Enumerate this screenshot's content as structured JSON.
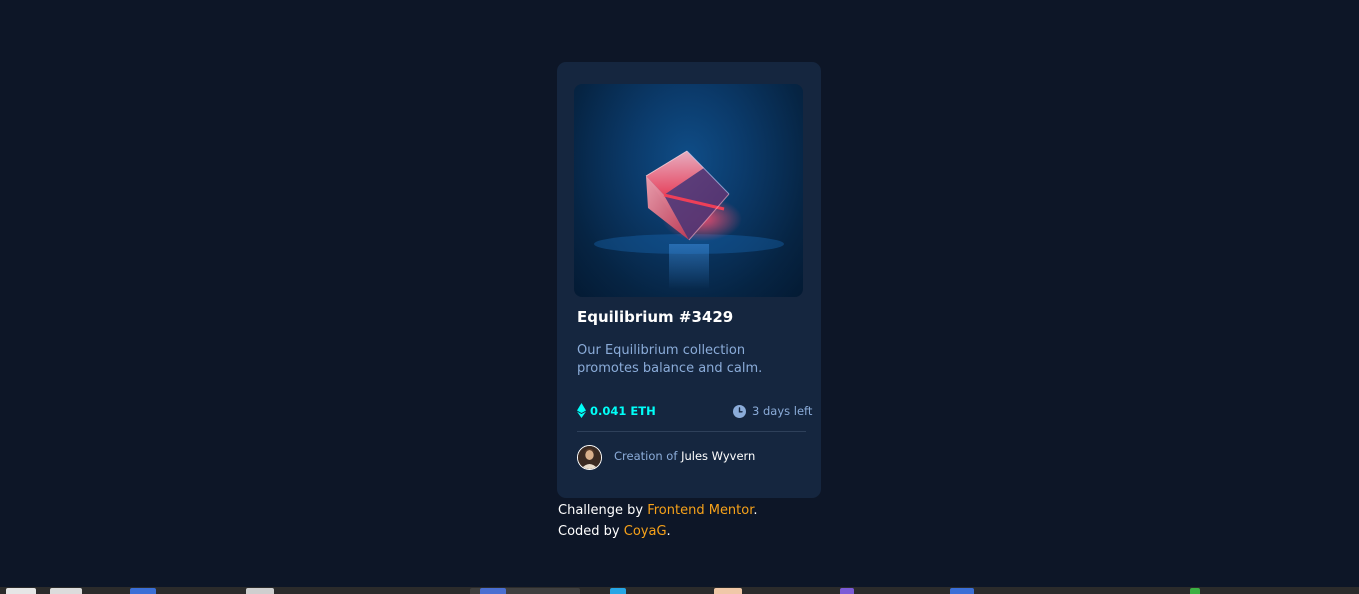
{
  "card": {
    "image_alt": "Equilibrium cube",
    "title": "Equilibrium #3429",
    "description": "Our Equilibrium collection promotes balance and calm.",
    "price": "0.041 ETH",
    "time_left": "3 days left",
    "creator_prefix": "Creation of ",
    "creator_name": "Jules Wyvern"
  },
  "attribution": {
    "challenge_prefix": "Challenge by ",
    "challenge_link": "Frontend Mentor",
    "challenge_suffix": ".",
    "coded_prefix": "Coded by ",
    "coded_link": "CoyaG",
    "coded_suffix": "."
  },
  "colors": {
    "background": "#0d1627",
    "card": "#15263f",
    "accent_cyan": "#00fff8",
    "soft_blue": "#8bacd9",
    "link_orange": "#f7a21a"
  },
  "taskbar": {
    "icons": [
      "app-icon",
      "app-icon",
      "app-icon",
      "app-icon",
      "app-icon",
      "app-icon",
      "app-icon",
      "app-icon",
      "app-icon",
      "app-icon",
      "app-icon"
    ]
  }
}
